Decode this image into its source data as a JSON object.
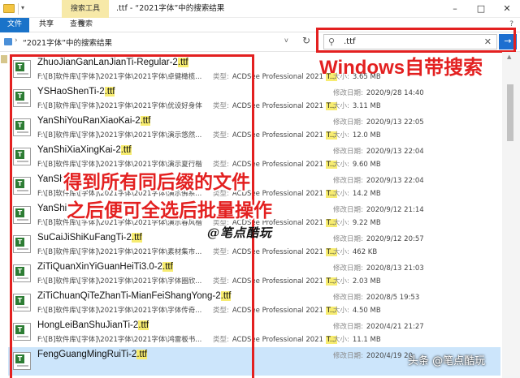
{
  "window": {
    "context_tab": "搜索工具",
    "title": ".ttf - “2021字体”中的搜索结果",
    "controls": {
      "minimize": "–",
      "maximize": "□",
      "close": "✕"
    }
  },
  "ribbon": {
    "tabs": [
      {
        "label": "文件"
      },
      {
        "label": "共享"
      },
      {
        "label": "查看"
      },
      {
        "label": "搜索"
      }
    ],
    "help": "?"
  },
  "address": {
    "path": "“2021字体”中的搜索结果",
    "dropdown": "v",
    "refresh": "↻"
  },
  "search": {
    "value": ".ttf",
    "clear": "✕",
    "go": "→"
  },
  "annotations": {
    "top": "Windows自带搜索",
    "line1": "得到所有同后缀的文件",
    "line2": "之后便可全选后批量操作",
    "signature": "@笔点酷玩",
    "watermark": "头条 @笔点酷玩"
  },
  "labels": {
    "type": "类型:",
    "modified": "修改日期:",
    "size": "大小:"
  },
  "files": [
    {
      "name": "ZhuoJianGanLanJianTi-Regular-2",
      "ext": ".ttf",
      "path": "F:\\[B]软件库\\[字体]\\2021字体\\2021字体\\卓健橄榄...",
      "type": "ACDSee Professional 2021",
      "type_badge": "T...",
      "modified": "",
      "size": "3.65 MB",
      "selected": false
    },
    {
      "name": "YSHaoShenTi-2",
      "ext": ".ttf",
      "path": "F:\\[B]软件库\\[字体]\\2021字体\\2021字体\\优设好身体",
      "type": "ACDSee Professional 2021",
      "type_badge": "T...",
      "modified": "2020/9/28 14:40",
      "size": "3.11 MB",
      "selected": false
    },
    {
      "name": "YanShiYouRanXiaoKai-2",
      "ext": ".ttf",
      "path": "F:\\[B]软件库\\[字体]\\2021字体\\2021字体\\演示悠然...",
      "type": "ACDSee Professional 2021",
      "type_badge": "T...",
      "modified": "2020/9/13 22:05",
      "size": "12.0 MB",
      "selected": false
    },
    {
      "name": "YanShiXiaXingKai-2",
      "ext": ".ttf",
      "path": "F:\\[B]软件库\\[字体]\\2021字体\\2021字体\\演示夏行楷",
      "type": "ACDSee Professional 2021",
      "type_badge": "T...",
      "modified": "2020/9/13 22:04",
      "size": "9.60 MB",
      "selected": false
    },
    {
      "name": "YanShi",
      "ext": "",
      "path": "F:\\[B]软件库\\[字体]\\2021字体\\2021字体\\演示佛系...",
      "type": "ACDSee Professional 2021",
      "type_badge": "T...",
      "modified": "2020/9/13 22:04",
      "size": "14.2 MB",
      "selected": false
    },
    {
      "name": "YanShi",
      "ext": "",
      "path": "F:\\[B]软件库\\[字体]\\2021字体\\2021字体\\演示春风楷",
      "type": "ACDSee Professional 2021",
      "type_badge": "T...",
      "modified": "2020/9/12 21:14",
      "size": "9.22 MB",
      "selected": false
    },
    {
      "name": "SuCaiJiShiKuFangTi-2",
      "ext": ".ttf",
      "path": "F:\\[B]软件库\\[字体]\\2021字体\\2021字体\\素材集市...",
      "type": "ACDSee Professional 2021",
      "type_badge": "T...",
      "modified": "2020/9/12 20:57",
      "size": "462 KB",
      "selected": false
    },
    {
      "name": "ZiTiQuanXinYiGuanHeiTi3.0-2",
      "ext": ".ttf",
      "path": "F:\\[B]软件库\\[字体]\\2021字体\\2021字体\\字体圈欣...",
      "type": "ACDSee Professional 2021",
      "type_badge": "T...",
      "modified": "2020/8/13 21:03",
      "size": "2.03 MB",
      "selected": false
    },
    {
      "name": "ZiTiChuanQiTeZhanTi-MianFeiShangYong-2",
      "ext": ".ttf",
      "path": "F:\\[B]软件库\\[字体]\\2021字体\\2021字体\\字体传奇...",
      "type": "ACDSee Professional 2021",
      "type_badge": "T...",
      "modified": "2020/8/5 19:53",
      "size": "4.50 MB",
      "selected": false
    },
    {
      "name": "HongLeiBanShuJianTi-2",
      "ext": ".ttf",
      "path": "F:\\[B]软件库\\[字体]\\2021字体\\2021字体\\鸿雷板书...",
      "type": "ACDSee Professional 2021",
      "type_badge": "T...",
      "modified": "2020/4/21 21:27",
      "size": "11.1 MB",
      "selected": false
    },
    {
      "name": "FengGuangMingRuiTi-2",
      "ext": ".ttf",
      "path": "",
      "type": "",
      "type_badge": "",
      "modified": "2020/4/19 20:",
      "size": "",
      "selected": true
    }
  ],
  "colors": {
    "annotation_red": "#e32020",
    "highlight_yellow": "#f7ec70",
    "context_tab_yellow": "#f7e9a8",
    "selection_blue": "#cce5fb",
    "accent_blue": "#1e6fd0"
  }
}
